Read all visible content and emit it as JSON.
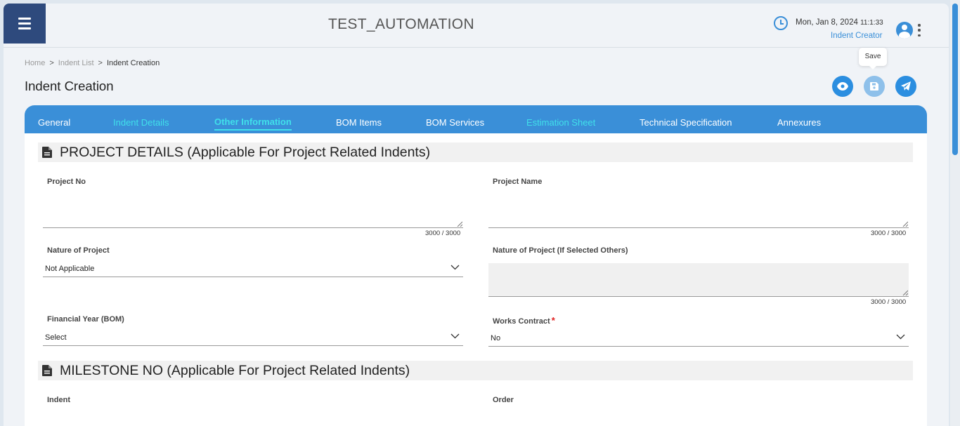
{
  "header": {
    "app_title": "TEST_AUTOMATION",
    "date": "Mon, Jan 8, 2024",
    "time": "11:1:33",
    "role": "Indent Creator",
    "icons": [
      "menu-icon",
      "clock-icon",
      "user-avatar-icon",
      "kebab-menu-icon"
    ]
  },
  "breadcrumb": [
    {
      "label": "Home"
    },
    {
      "label": "Indent List"
    },
    {
      "label": "Indent Creation"
    }
  ],
  "breadcrumb_sep": ">",
  "page_title": "Indent Creation",
  "actions": {
    "tooltip": "Save",
    "icons": [
      "eye-icon",
      "save-icon",
      "send-icon"
    ]
  },
  "tabs": [
    {
      "label": "General"
    },
    {
      "label": "Indent Details"
    },
    {
      "label": "Other Information"
    },
    {
      "label": "BOM Items"
    },
    {
      "label": "BOM Services"
    },
    {
      "label": "Estimation Sheet"
    },
    {
      "label": "Technical Specification"
    },
    {
      "label": "Annexures"
    }
  ],
  "active_tab": "Other Information",
  "project_section": {
    "title": "PROJECT DETAILS (Applicable For Project Related Indents)",
    "project_no": {
      "label": "Project No",
      "value": "",
      "counter": "3000 / 3000"
    },
    "project_name": {
      "label": "Project Name",
      "value": "",
      "counter": "3000 / 3000"
    },
    "nature": {
      "label": "Nature of Project",
      "value": "Not Applicable"
    },
    "nature_other": {
      "label": "Nature of Project (If Selected Others)",
      "value": "",
      "counter": "3000 / 3000"
    },
    "fin_year": {
      "label": "Financial Year (BOM)",
      "value": "Select"
    },
    "works_contract": {
      "label": "Works Contract",
      "required_mark": "*",
      "value": "No"
    }
  },
  "milestone_section": {
    "title": "MILESTONE NO (Applicable For Project Related Indents)",
    "indent_label": "Indent",
    "order_label": "Order"
  },
  "colors": {
    "primary": "#3a8fd8",
    "menu_bg": "#2e4a7d",
    "tab_active": "#40e0ea",
    "required": "#e02020"
  }
}
